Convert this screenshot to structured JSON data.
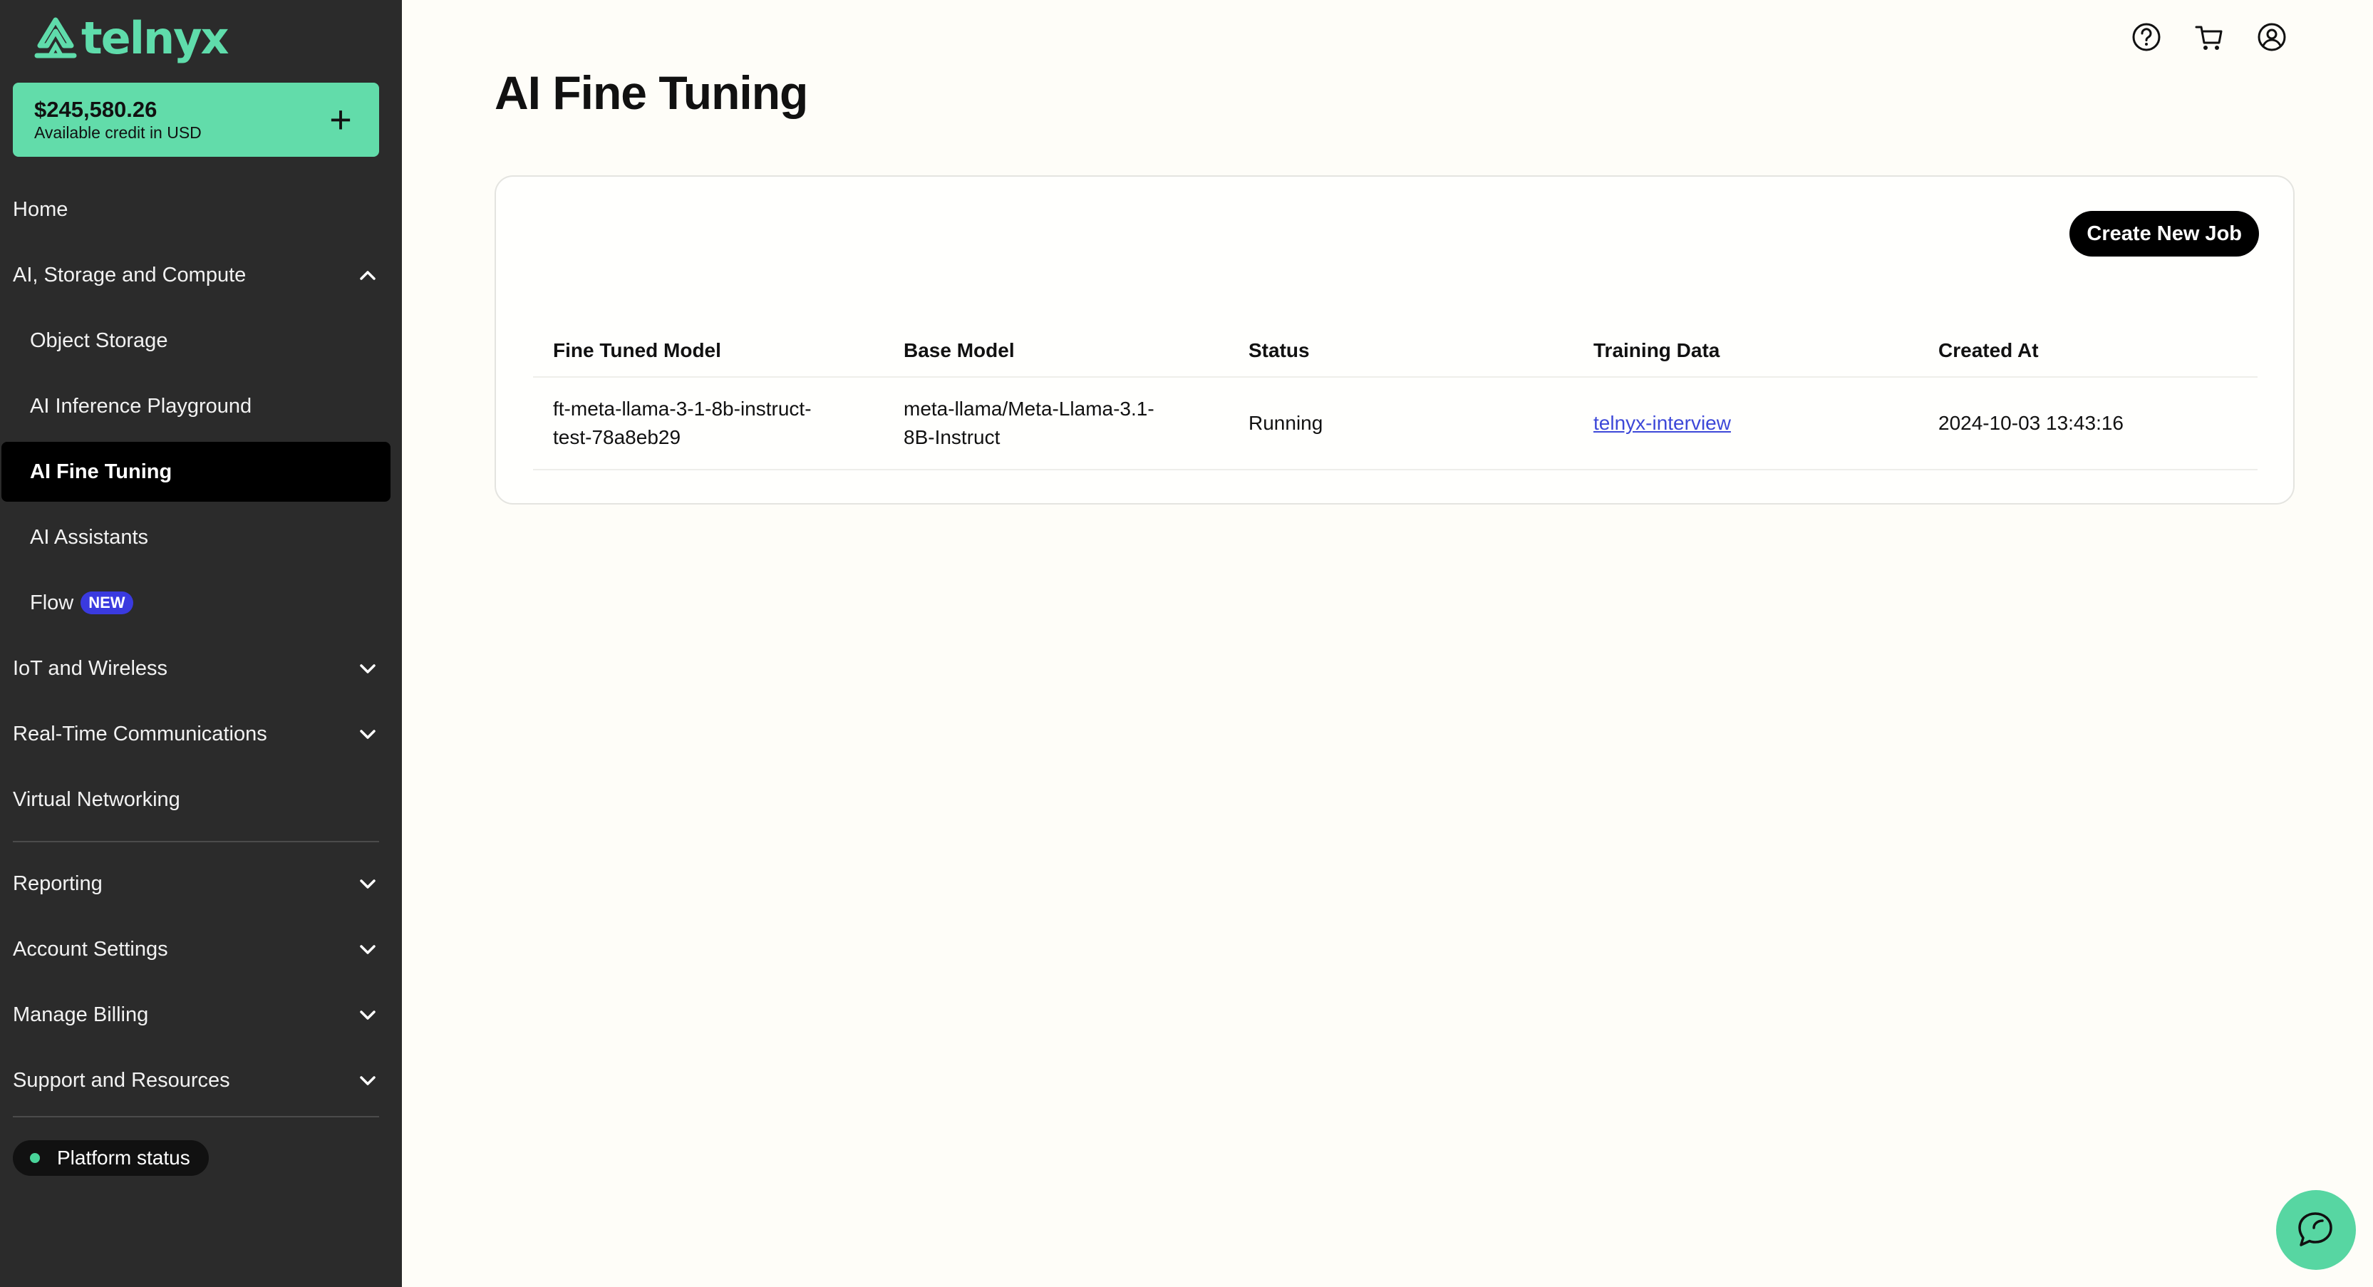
{
  "brand": {
    "name": "telnyx",
    "color": "#5fdcab"
  },
  "credit": {
    "amount": "$245,580.26",
    "label": "Available credit in USD"
  },
  "sidebar": {
    "items": [
      {
        "label": "Home"
      },
      {
        "label": "AI, Storage and Compute"
      },
      {
        "label": "Object Storage"
      },
      {
        "label": "AI Inference Playground"
      },
      {
        "label": "AI Fine Tuning"
      },
      {
        "label": "AI Assistants"
      },
      {
        "label": "Flow",
        "badge": "NEW"
      },
      {
        "label": "IoT and Wireless"
      },
      {
        "label": "Real-Time Communications"
      },
      {
        "label": "Virtual Networking"
      },
      {
        "label": "Reporting"
      },
      {
        "label": "Account Settings"
      },
      {
        "label": "Manage Billing"
      },
      {
        "label": "Support and Resources"
      }
    ],
    "platform_status": "Platform status"
  },
  "header": {
    "icons": [
      "help-icon",
      "cart-icon",
      "account-icon"
    ]
  },
  "main": {
    "title": "AI Fine Tuning",
    "create_button": "Create New Job",
    "table": {
      "columns": [
        "Fine Tuned Model",
        "Base Model",
        "Status",
        "Training Data",
        "Created At"
      ],
      "rows": [
        {
          "fine_tuned_model_line1": "ft-meta-llama-3-1-8b-instruct-",
          "fine_tuned_model_line2": "test-78a8eb29",
          "base_model_line1": "meta-llama/Meta-Llama-3.1-",
          "base_model_line2": "8B-Instruct",
          "status": "Running",
          "training_data": "telnyx-interview",
          "created_at": "2024-10-03 13:43:16"
        }
      ]
    }
  },
  "colors": {
    "sidebar_bg": "#2b2b2b",
    "accent_green": "#62dcaa",
    "active_bg": "#000000",
    "badge_blue": "#3a3adf",
    "link_blue": "#3d48d8",
    "page_bg": "#fefdf8"
  }
}
